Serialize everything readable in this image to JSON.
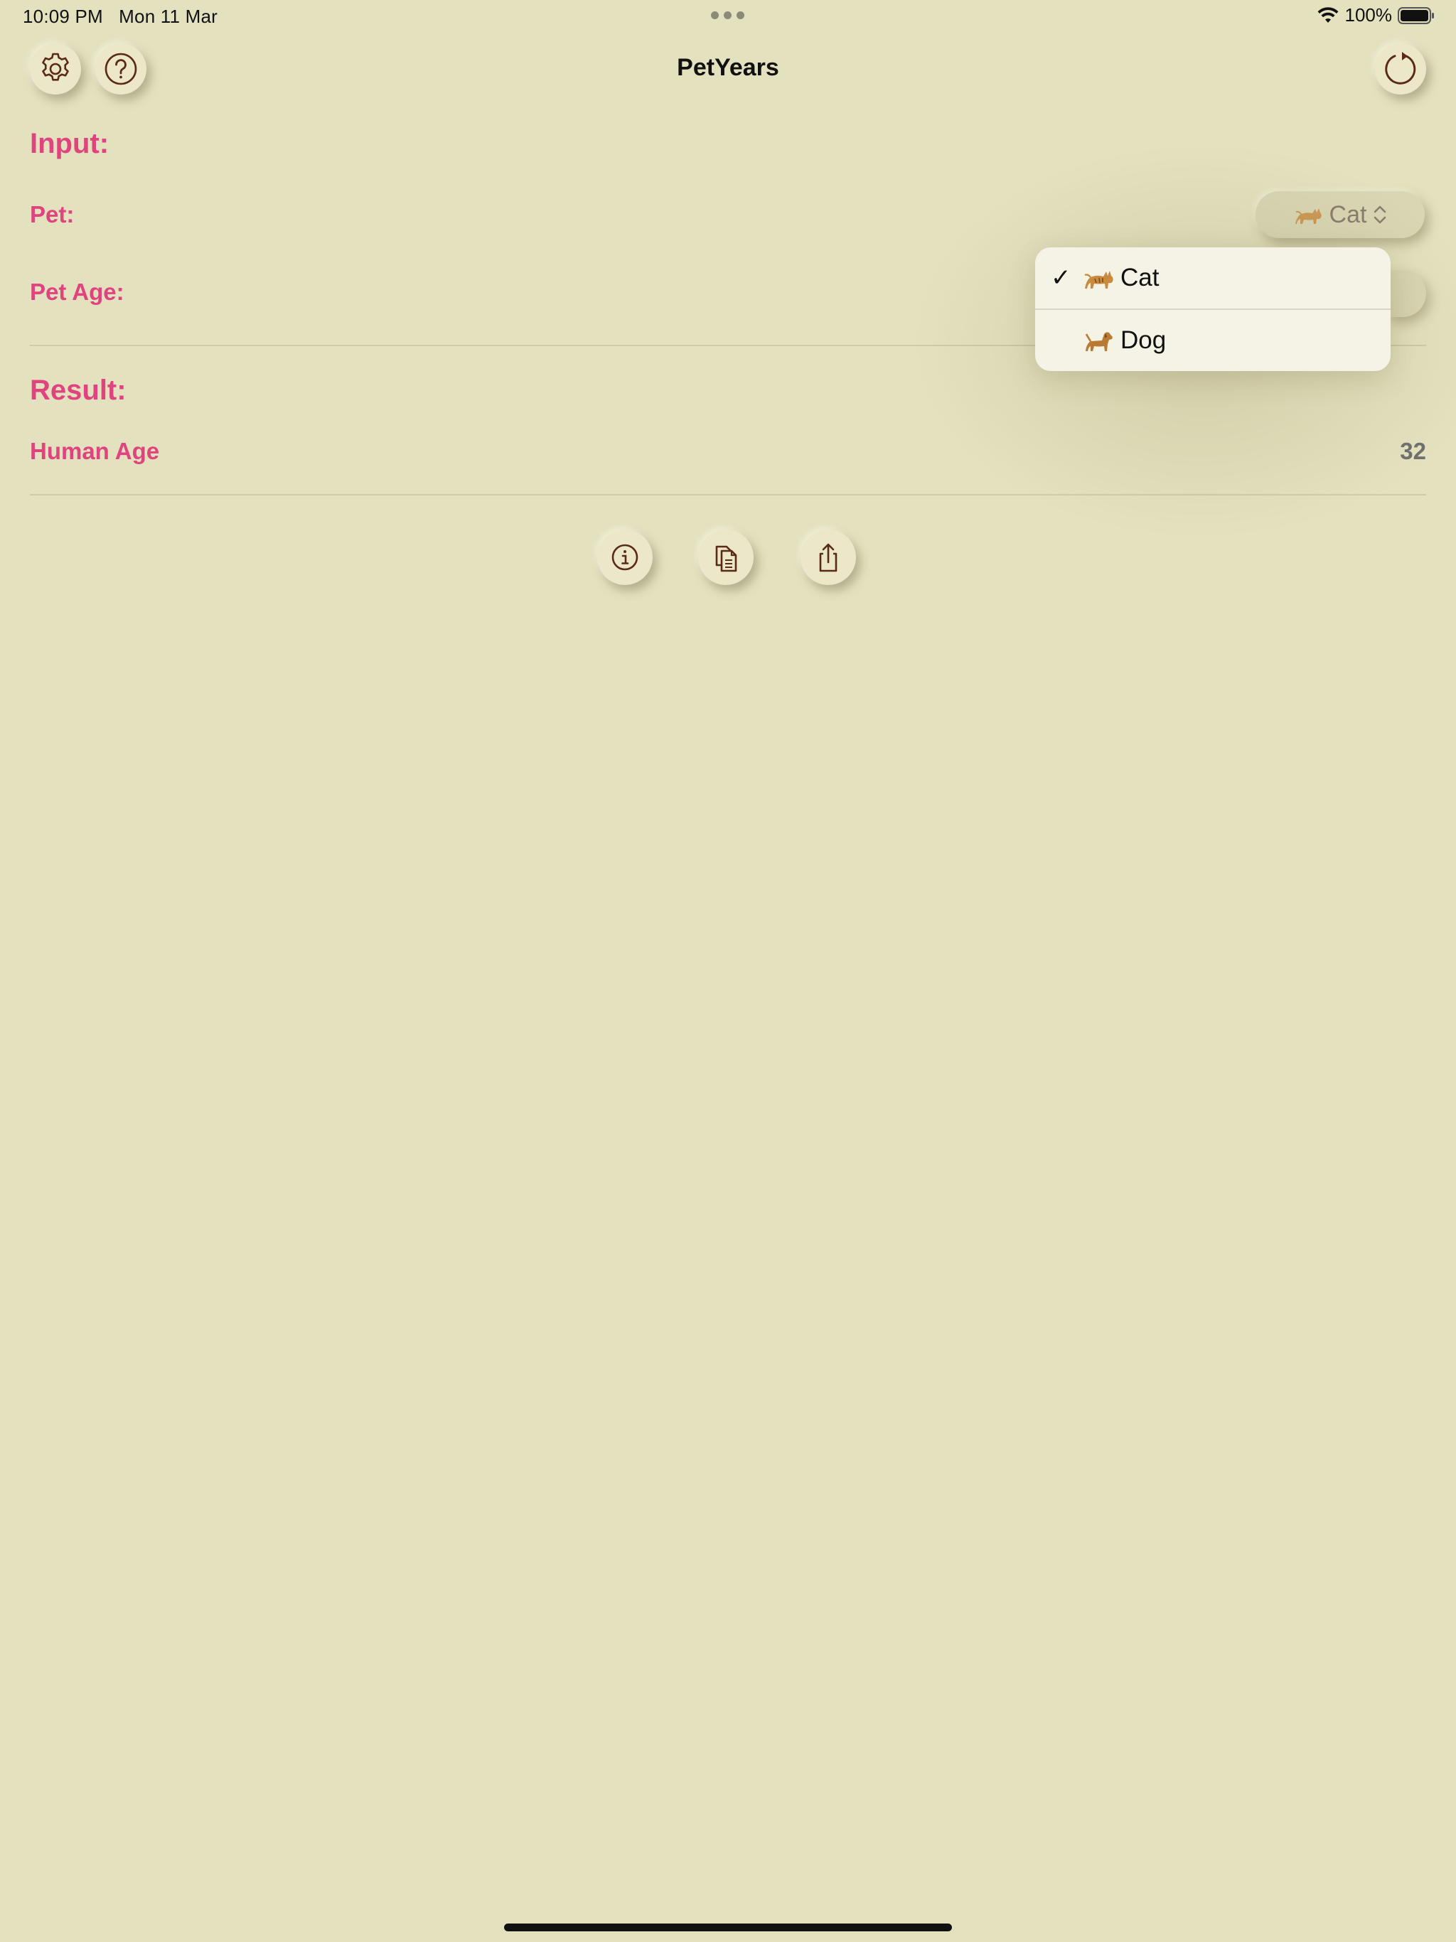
{
  "status_bar": {
    "time": "10:09 PM",
    "date": "Mon 11 Mar",
    "battery": "100%",
    "icons": [
      "wifi-icon",
      "battery-icon"
    ]
  },
  "nav": {
    "title": "PetYears",
    "left_buttons": [
      "gear-icon",
      "question-icon"
    ],
    "right_button": "reset-icon"
  },
  "input_section": {
    "title": "Input:",
    "pet_label": "Pet:",
    "pet_value": "Cat",
    "pet_age_label": "Pet Age:"
  },
  "result_section": {
    "title": "Result:",
    "human_age_label": "Human Age",
    "human_age_value": "32"
  },
  "pet_menu": {
    "items": [
      {
        "label": "Cat",
        "icon": "cat-emoji-icon",
        "selected": true
      },
      {
        "label": "Dog",
        "icon": "dog-emoji-icon",
        "selected": false
      }
    ],
    "check_glyph": "✓"
  },
  "actions": [
    "info-icon",
    "copy-icon",
    "share-icon"
  ],
  "colors": {
    "background": "#e4e1bf",
    "accent_pink": "#e0447f",
    "icon_brown": "#5a2a16",
    "value_gray": "#6f6f6f"
  }
}
